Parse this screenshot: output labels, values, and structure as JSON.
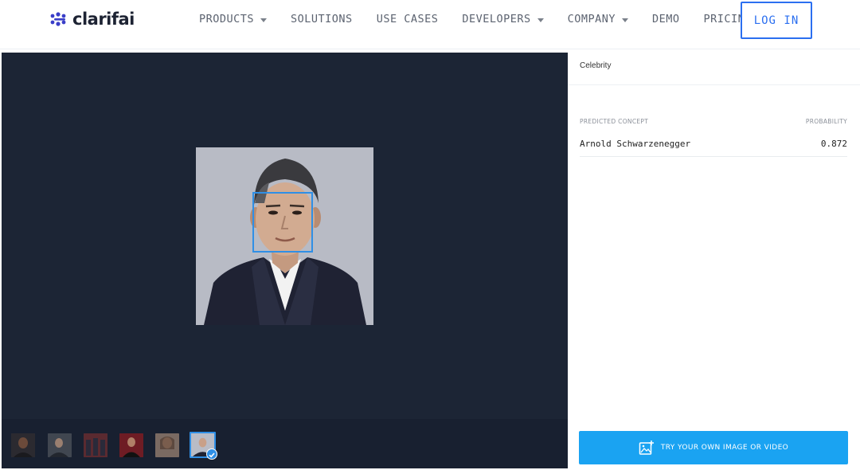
{
  "header": {
    "brand": "clarifai",
    "nav": [
      {
        "label": "PRODUCTS",
        "has_caret": true
      },
      {
        "label": "SOLUTIONS",
        "has_caret": false
      },
      {
        "label": "USE CASES",
        "has_caret": false
      },
      {
        "label": "DEVELOPERS",
        "has_caret": true
      },
      {
        "label": "COMPANY",
        "has_caret": true
      },
      {
        "label": "DEMO",
        "has_caret": false
      },
      {
        "label": "PRICING",
        "has_caret": false
      }
    ],
    "login_label": "LOG IN"
  },
  "panel": {
    "model_name": "Celebrity",
    "column_concept": "PREDICTED CONCEPT",
    "column_probability": "PROBABILITY",
    "predictions": [
      {
        "concept": "Arnold Schwarzenegger",
        "probability": "0.872"
      }
    ],
    "try_button_label": "TRY YOUR OWN IMAGE OR VIDEO",
    "try_button_icon": "add-image-icon"
  },
  "viewer": {
    "thumbnails_count": 6,
    "selected_thumbnail": 6
  },
  "colors": {
    "brand": "#3a3ec8",
    "accent": "#2b6ff0",
    "viewer_bg": "#1c2535",
    "button_bg": "#1aa3f2",
    "face_box": "#2f8fe6"
  }
}
